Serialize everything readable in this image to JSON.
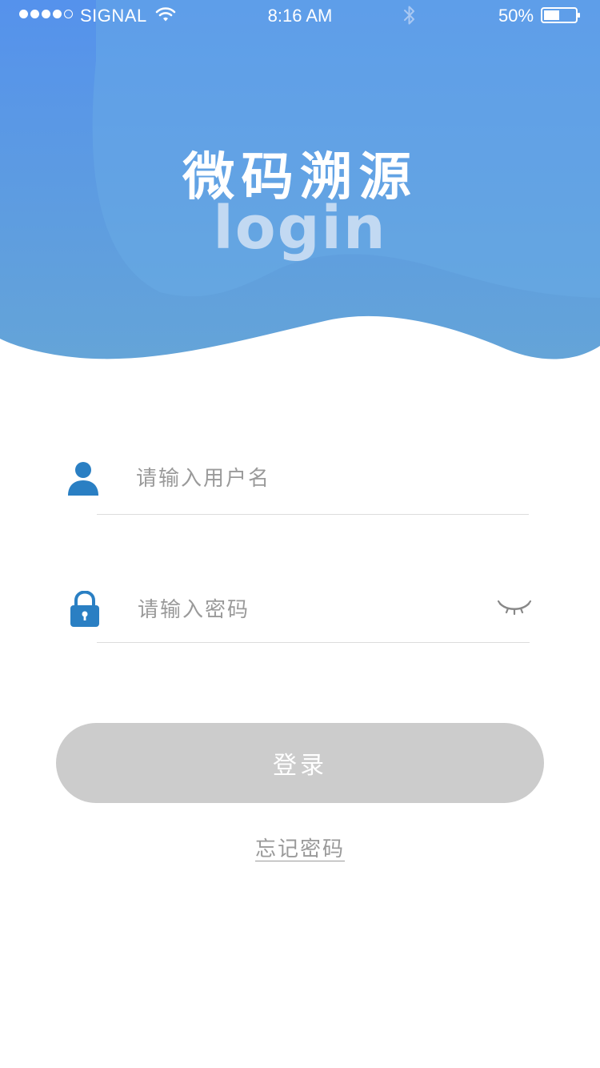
{
  "status_bar": {
    "carrier": "SIGNAL",
    "time": "8:16 AM",
    "battery_percent": "50%",
    "battery_level": 0.5,
    "signal_bars_filled": 4,
    "signal_bars_total": 5,
    "icons": [
      "wifi-icon",
      "bluetooth-icon",
      "battery-icon"
    ]
  },
  "header": {
    "app_title": "微码溯源",
    "subtitle": "login"
  },
  "form": {
    "username": {
      "placeholder": "请输入用户名",
      "value": "",
      "icon": "user-icon"
    },
    "password": {
      "placeholder": "请输入密码",
      "value": "",
      "icon": "lock-icon",
      "toggle_icon": "eye-closed-icon"
    },
    "login_label": "登录",
    "forgot_label": "忘记密码"
  },
  "colors": {
    "header_gradient_top": "#5592ec",
    "header_gradient_bottom": "#64a6d8",
    "icon_blue": "#2a7fc3",
    "button_disabled": "#cccccc",
    "divider": "#dcdcdc",
    "placeholder_text": "#9a9a9a"
  }
}
